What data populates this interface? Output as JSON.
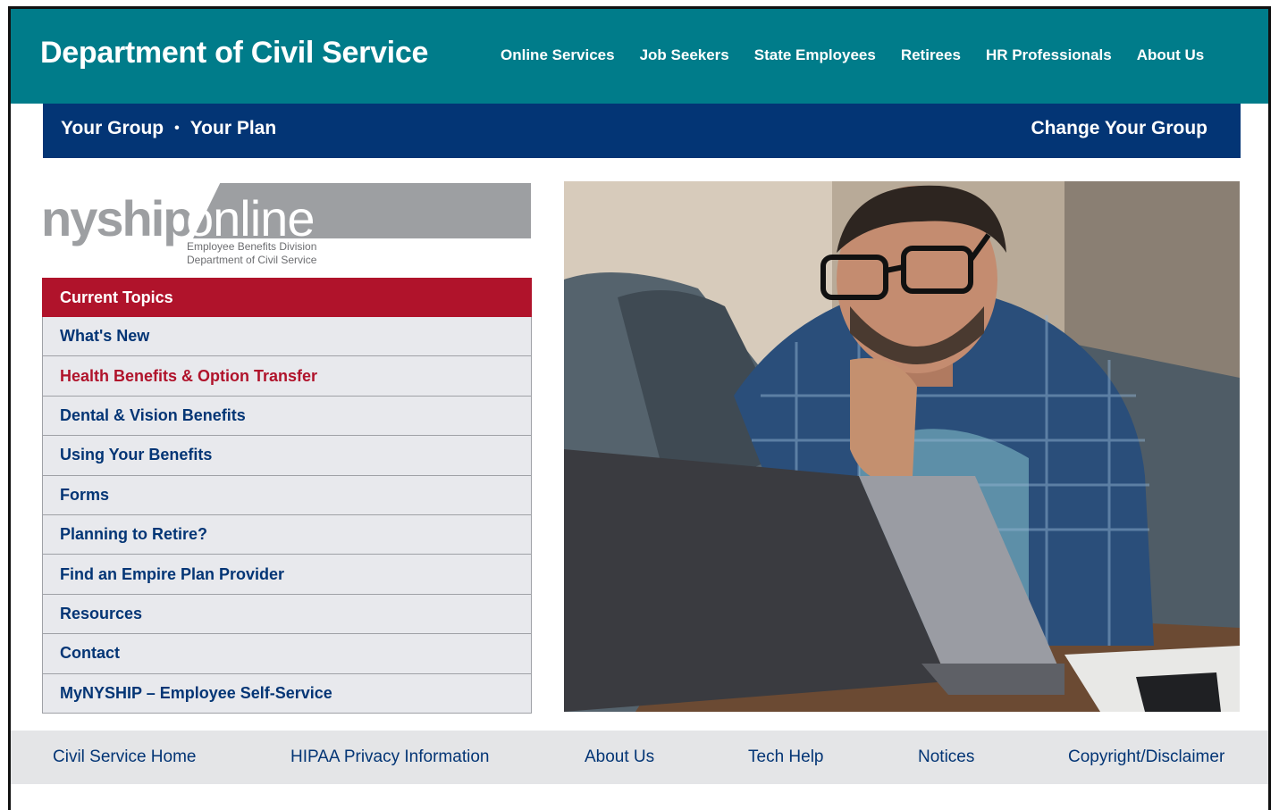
{
  "header": {
    "site_title": "Department of Civil Service",
    "nav": [
      "Online Services",
      "Job Seekers",
      "State Employees",
      "Retirees",
      "HR Professionals",
      "About Us"
    ]
  },
  "group_bar": {
    "your_group": "Your Group",
    "separator": "•",
    "your_plan": "Your Plan",
    "change_group": "Change Your Group"
  },
  "logo": {
    "word_a": "nyship",
    "word_b": "online",
    "line1": "Employee Benefits Division",
    "line2": "Department of Civil Service"
  },
  "menu": {
    "header": "Current Topics",
    "items": [
      "What's New",
      "Health Benefits & Option Transfer",
      "Dental & Vision Benefits",
      "Using Your Benefits",
      "Forms",
      "Planning to Retire?",
      "Find an Empire Plan Provider",
      "Resources",
      "Contact",
      "MyNYSHIP – Employee Self-Service"
    ],
    "active_index": 1
  },
  "footer": {
    "links": [
      "Civil Service Home",
      "HIPAA Privacy Information",
      "About Us",
      "Tech Help",
      "Notices",
      "Copyright/Disclaimer"
    ]
  },
  "colors": {
    "top_bar": "#007c8a",
    "group_bar": "#033575",
    "menu_header": "#b0132b",
    "active_link": "#b0132b",
    "link": "#033575"
  }
}
